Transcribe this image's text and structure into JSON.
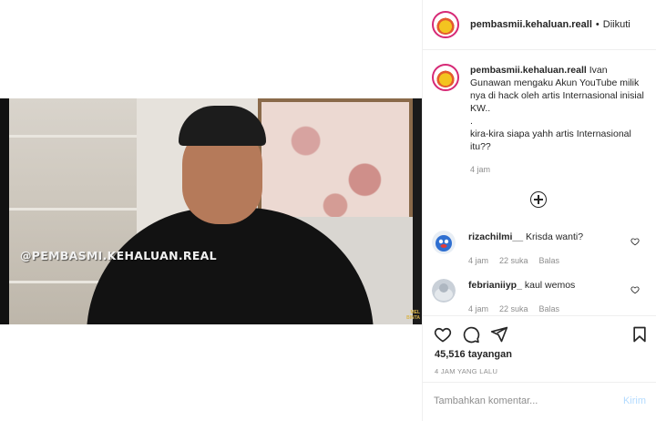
{
  "media": {
    "watermark": "@PEMBASMI.KEHALUAN.REAL",
    "corner_mark_1": "MEL",
    "corner_mark_2": "BINTA"
  },
  "header": {
    "username": "pembasmii.kehaluan.reall",
    "separator": "•",
    "follow_status": "Diikuti"
  },
  "caption": {
    "username": "pembasmii.kehaluan.reall",
    "text": "Ivan Gunawan mengaku Akun YouTube milik nya di hack oleh artis Internasional inisial KW..\n.\nkira-kira siapa yahh artis Internasional itu??",
    "time": "4 jam"
  },
  "comments": [
    {
      "username": "rizachilmi__",
      "text": "Krisda wanti?",
      "time": "4 jam",
      "likes": "22 suka",
      "reply": "Balas"
    },
    {
      "username": "febrianiiyp_",
      "text": "kaul wemos",
      "time": "4 jam",
      "likes": "22 suka",
      "reply": "Balas"
    }
  ],
  "stats": {
    "views": "45,516 tayangan",
    "posted_ago": "4 JAM YANG LALU"
  },
  "add_comment": {
    "placeholder": "Tambahkan komentar...",
    "send_label": "Kirim"
  },
  "icons": {
    "like": "heart-icon",
    "comment": "comment-icon",
    "share": "send-icon",
    "save": "bookmark-icon",
    "load_more": "plus-circle-icon"
  },
  "colors": {
    "story_ring": "#d62976",
    "muted": "#8e8e8e",
    "send_disabled": "#b3dbff"
  }
}
